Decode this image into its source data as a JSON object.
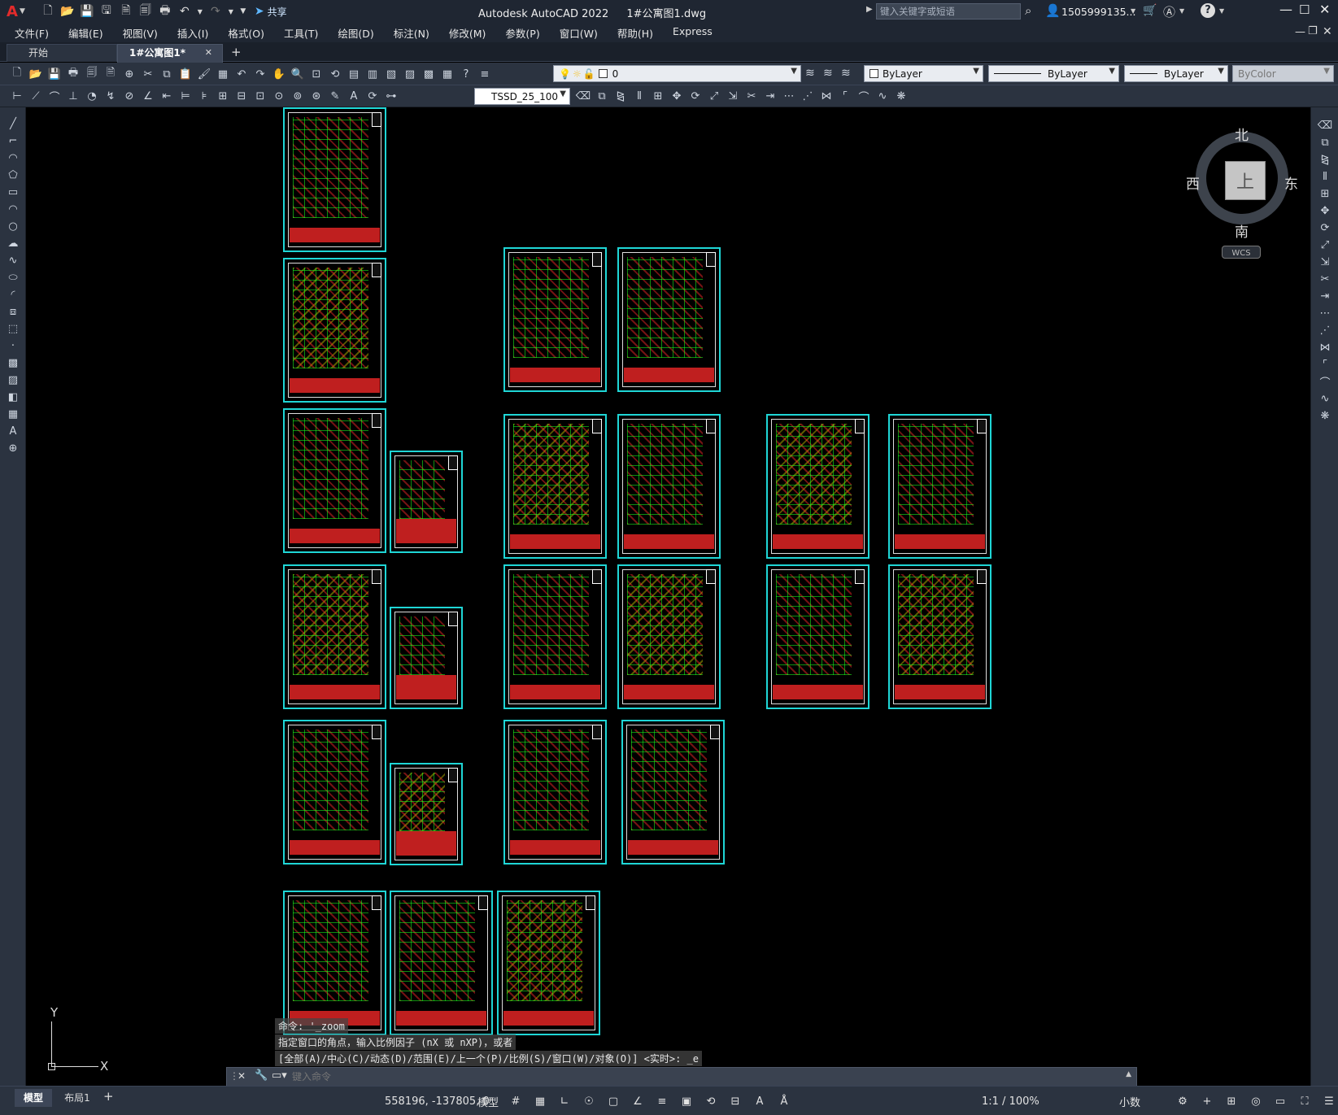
{
  "app": {
    "logo": "A",
    "title": "Autodesk AutoCAD 2022",
    "filename": "1#公寓图1.dwg",
    "share_label": "共享",
    "search_placeholder": "键入关键字或短语",
    "user": "1505999135...",
    "help": "?"
  },
  "menu": [
    "文件(F)",
    "编辑(E)",
    "视图(V)",
    "插入(I)",
    "格式(O)",
    "工具(T)",
    "绘图(D)",
    "标注(N)",
    "修改(M)",
    "参数(P)",
    "窗口(W)",
    "帮助(H)",
    "Express"
  ],
  "tabs": {
    "start": "开始",
    "doc": "1#公寓图1*",
    "close": "✕",
    "add": "+"
  },
  "toolbar": {
    "layer_value": "0",
    "color_value": "ByLayer",
    "linetype_value": "ByLayer",
    "lineweight_value": "ByLayer",
    "plotstyle_value": "ByColor",
    "dimstyle_value": "TSSD_25_100"
  },
  "viewcube": {
    "north": "北",
    "south": "南",
    "east": "东",
    "west": "西",
    "top": "上",
    "wcs": "WCS"
  },
  "ucs": {
    "x": "X",
    "y": "Y"
  },
  "command": {
    "line1": "命令: '_zoom",
    "line2": "指定窗口的角点，输入比例因子 (nX 或 nXP)，或者",
    "line3": "[全部(A)/中心(C)/动态(D)/范围(E)/上一个(P)/比例(S)/窗口(W)/对象(O)] <实时>: _e",
    "placeholder": "键入命令"
  },
  "status": {
    "model_tab": "模型",
    "layout_tab": "布局1",
    "add": "+",
    "coords": "558196, -137805, 0",
    "space": "模型",
    "scale": "1:1 / 100%",
    "units": "小数"
  },
  "colors": {
    "sheet_border": "#1fd6d6",
    "accent_red": "#ff2a2a",
    "green_grid": "#1cff1c",
    "bg_ui": "#2b3340"
  }
}
